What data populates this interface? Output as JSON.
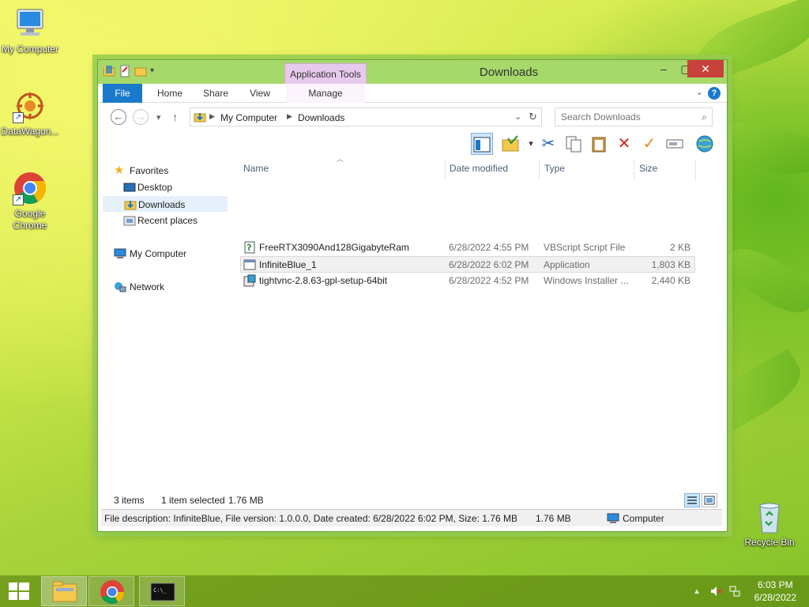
{
  "desktop": {
    "icons": [
      {
        "label": "My Computer"
      },
      {
        "label": "DataWagon..."
      },
      {
        "label": "Google Chrome"
      },
      {
        "label": "Recycle Bin"
      }
    ]
  },
  "window": {
    "title": "Downloads",
    "context_tab": "Application Tools",
    "ribbon_tabs": [
      "File",
      "Home",
      "Share",
      "View",
      "Manage"
    ],
    "address": {
      "crumbs": [
        "My Computer",
        "Downloads"
      ]
    },
    "search": {
      "placeholder": "Search Downloads"
    },
    "nav_pane": {
      "favorites": "Favorites",
      "desktop": "Desktop",
      "downloads": "Downloads",
      "recent": "Recent places",
      "my_computer": "My Computer",
      "network": "Network"
    },
    "columns": {
      "name": "Name",
      "date": "Date modified",
      "type": "Type",
      "size": "Size"
    },
    "files": [
      {
        "name": "FreeRTX3090And128GigabyteRam",
        "date": "6/28/2022 4:55 PM",
        "type": "VBScript Script File",
        "size": "2 KB",
        "icon": "script-icon"
      },
      {
        "name": "InfiniteBlue_1",
        "date": "6/28/2022 6:02 PM",
        "type": "Application",
        "size": "1,803 KB",
        "icon": "application-icon"
      },
      {
        "name": "tightvnc-2.8.63-gpl-setup-64bit",
        "date": "6/28/2022 4:52 PM",
        "type": "Windows Installer ...",
        "size": "2,440 KB",
        "icon": "installer-icon"
      }
    ],
    "status": {
      "items": "3 items",
      "selected": "1 item selected",
      "selected_size": "1.76 MB"
    },
    "details": {
      "description": "File description: InfiniteBlue, File version: 1.0.0.0, Date created: 6/28/2022 6:02 PM, Size: 1.76 MB",
      "size": "1.76 MB",
      "location": "Computer"
    }
  },
  "taskbar": {
    "time": "6:03 PM",
    "date": "6/28/2022"
  },
  "colors": {
    "accent": "#1979ca",
    "titlebar": "#a6d86a",
    "context_tab": "#e8c9ee",
    "close": "#c7423a"
  }
}
